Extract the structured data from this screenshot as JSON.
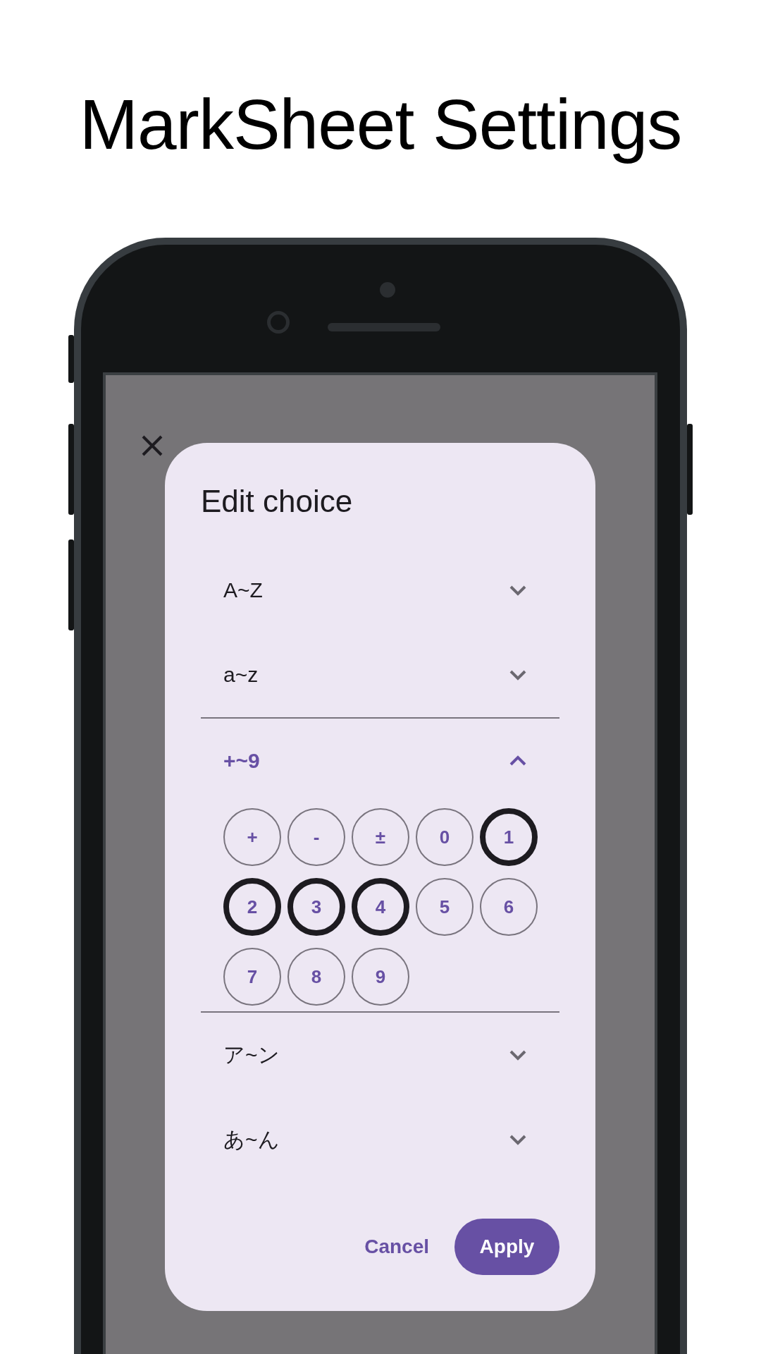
{
  "header": {
    "title": "MarkSheet Settings"
  },
  "dialog": {
    "title": "Edit choice",
    "groups": [
      {
        "label": "A~Z",
        "expanded": false
      },
      {
        "label": "a~z",
        "expanded": false
      },
      {
        "label": "+~9",
        "expanded": true,
        "choices": [
          {
            "label": "+",
            "selected": false
          },
          {
            "label": "-",
            "selected": false
          },
          {
            "label": "±",
            "selected": false
          },
          {
            "label": "0",
            "selected": false
          },
          {
            "label": "1",
            "selected": true
          },
          {
            "label": "2",
            "selected": true
          },
          {
            "label": "3",
            "selected": true
          },
          {
            "label": "4",
            "selected": true
          },
          {
            "label": "5",
            "selected": false
          },
          {
            "label": "6",
            "selected": false
          },
          {
            "label": "7",
            "selected": false
          },
          {
            "label": "8",
            "selected": false
          },
          {
            "label": "9",
            "selected": false
          }
        ]
      },
      {
        "label": "ア~ン",
        "expanded": false
      },
      {
        "label": "あ~ん",
        "expanded": false
      }
    ],
    "actions": [
      {
        "label": "Cancel",
        "kind": "text"
      },
      {
        "label": "Apply",
        "kind": "filled"
      }
    ]
  }
}
